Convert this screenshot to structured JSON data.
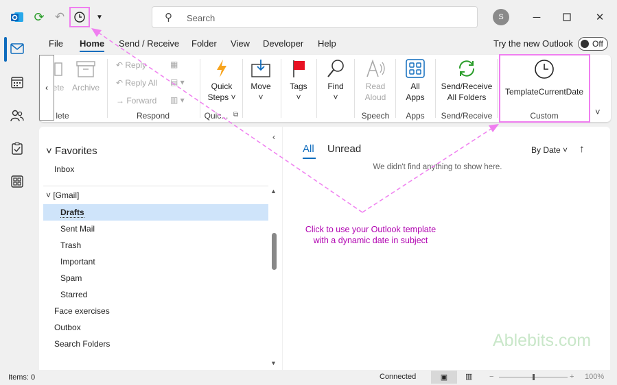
{
  "titlebar": {
    "search_placeholder": "Search",
    "avatar_initial": "S"
  },
  "menu": {
    "tabs": [
      "File",
      "Home",
      "Send / Receive",
      "Folder",
      "View",
      "Developer",
      "Help"
    ],
    "active": "Home",
    "try_new": "Try the new Outlook",
    "toggle_label": "Off"
  },
  "ribbon": {
    "delete_partial": "ete",
    "delete_group_partial": "lete",
    "archive": "Archive",
    "reply": "Reply",
    "reply_all": "Reply All",
    "forward": "Forward",
    "respond_group": "Respond",
    "quick_steps": [
      "Quick",
      "Steps"
    ],
    "quick_group": "Quic...",
    "move": "Move",
    "tags": "Tags",
    "find": "Find",
    "read_aloud": [
      "Read",
      "Aloud"
    ],
    "speech_group": "Speech",
    "all_apps": [
      "All",
      "Apps"
    ],
    "apps_group": "Apps",
    "send_receive_all": [
      "Send/Receive",
      "All Folders"
    ],
    "send_receive_group": "Send/Receive",
    "template": "TemplateCurrentDate",
    "custom_group": "Custom"
  },
  "folders": {
    "favorites": "Favorites",
    "inbox": "Inbox",
    "gmail": "[Gmail]",
    "gmail_items": [
      "Drafts",
      "Sent Mail",
      "Trash",
      "Important",
      "Spam",
      "Starred"
    ],
    "selected": "Drafts",
    "other_items": [
      "Face exercises",
      "Outbox",
      "Search Folders"
    ]
  },
  "messages": {
    "tab_all": "All",
    "tab_unread": "Unread",
    "sort": "By Date",
    "empty": "We didn't find anything to show here."
  },
  "status": {
    "items": "Items: 0",
    "connected": "Connected",
    "zoom": "100%"
  },
  "annotation": {
    "line1": "Click to use your Outlook template",
    "line2": "with a dynamic date in subject"
  },
  "watermark": "Ablebits.com",
  "colors": {
    "accent": "#0f6cbd",
    "annotation": "#b000b0",
    "highlight": "#f07ef0",
    "outlook_blue": "#0a64b8",
    "flag_red": "#e81123",
    "lightning": "#f7a31c",
    "sync_green": "#2a9d2a"
  }
}
